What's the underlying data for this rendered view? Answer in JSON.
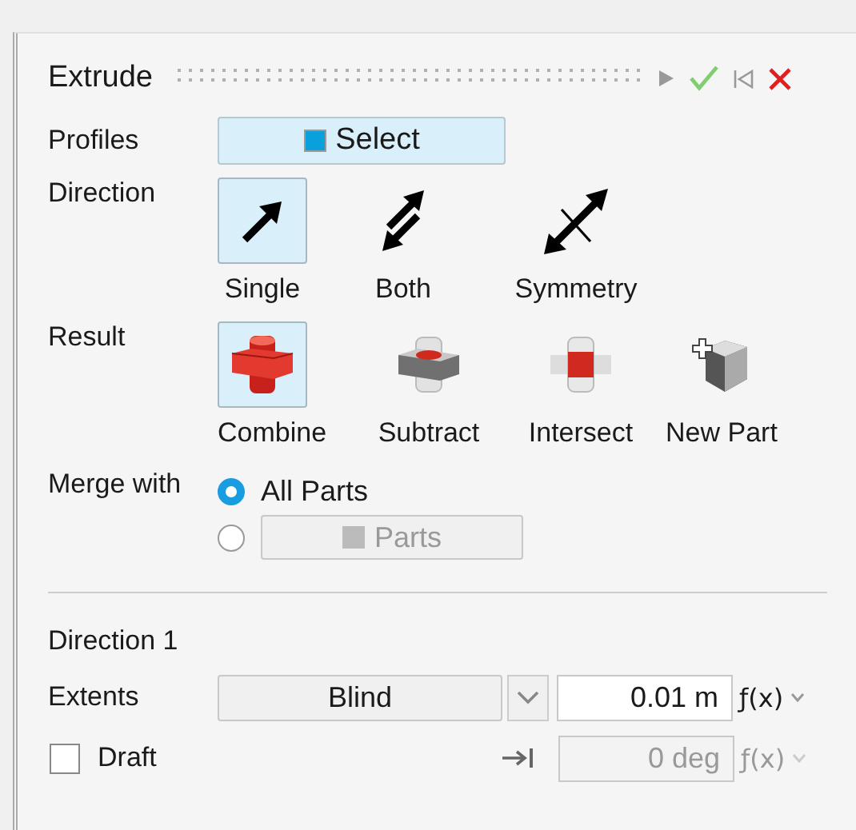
{
  "panel": {
    "title": "Extrude"
  },
  "profiles": {
    "label": "Profiles",
    "button": "Select"
  },
  "direction": {
    "label": "Direction",
    "options": [
      {
        "kind": "single",
        "label": "Single",
        "selected": true
      },
      {
        "kind": "both",
        "label": "Both",
        "selected": false
      },
      {
        "kind": "symmetry",
        "label": "Symmetry",
        "selected": false
      }
    ]
  },
  "result": {
    "label": "Result",
    "options": [
      {
        "kind": "combine",
        "label": "Combine",
        "selected": true
      },
      {
        "kind": "subtract",
        "label": "Subtract",
        "selected": false
      },
      {
        "kind": "intersect",
        "label": "Intersect",
        "selected": false
      },
      {
        "kind": "newpart",
        "label": "New Part",
        "selected": false
      }
    ]
  },
  "merge": {
    "label": "Merge with",
    "options": [
      {
        "kind": "text",
        "label": "All Parts",
        "selected": true,
        "disabled": false
      },
      {
        "kind": "button",
        "label": "Parts",
        "selected": false,
        "disabled": true
      }
    ]
  },
  "direction_1": {
    "title": "Direction 1",
    "extents": {
      "label": "Extents",
      "type": "Blind",
      "value": "0.01 m",
      "fx": "ƒ(x)",
      "disabled": false
    },
    "draft": {
      "label": "Draft",
      "checked": false,
      "value": "0 deg",
      "fx": "ƒ(x)",
      "disabled": true
    }
  }
}
